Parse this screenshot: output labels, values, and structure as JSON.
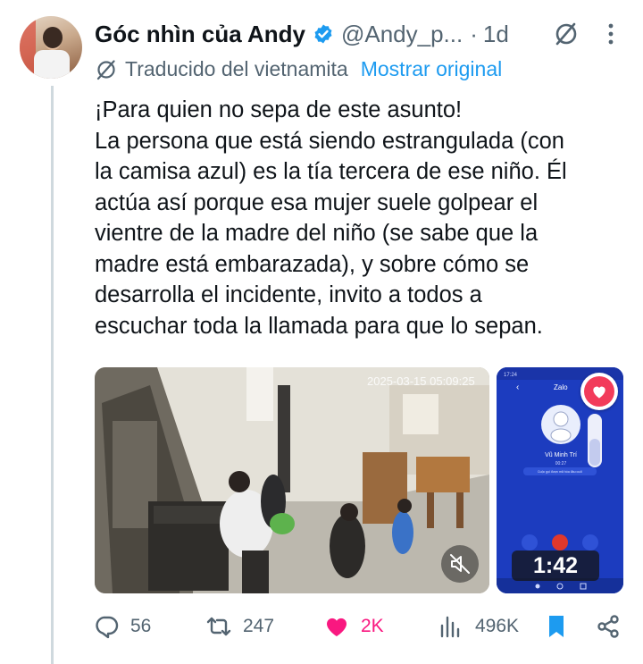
{
  "author": {
    "name": "Góc nhìn của Andy",
    "handle": "@Andy_p...",
    "separator": "·",
    "time": "1d"
  },
  "translation": {
    "label": "Traducido del vietnamita",
    "action": "Mostrar original"
  },
  "tweet_lines": [
    "¡Para quien no sepa de este asunto!",
    "La persona que está siendo estrangulada (con",
    "la camisa azul) es la tía tercera de ese niño. Él",
    "actúa así porque esa mujer suele golpear el",
    "vientre de la madre del niño (se sabe que la",
    "madre está embarazada), y sobre cómo se",
    "desarrolla el incidente, invito a todos a",
    "escuchar toda la llamada para que lo sepan."
  ],
  "media": {
    "cctv_timestamp": "2025-03-15 05:09:25",
    "phone": {
      "status_time": "17:24",
      "app_name": "Zalo",
      "contact_name": "Vũ Minh Trí",
      "call_timer": "00:27",
      "notice": "Cuộc gọi được mã hóa đầu cuối"
    },
    "duration": "1:42"
  },
  "actions": {
    "replies": "56",
    "reposts": "247",
    "likes": "2K",
    "views": "496K"
  },
  "colors": {
    "text": "#0f1419",
    "muted": "#536471",
    "link": "#1d9bf0",
    "like": "#f91880",
    "verified": "#1d9bf0"
  }
}
